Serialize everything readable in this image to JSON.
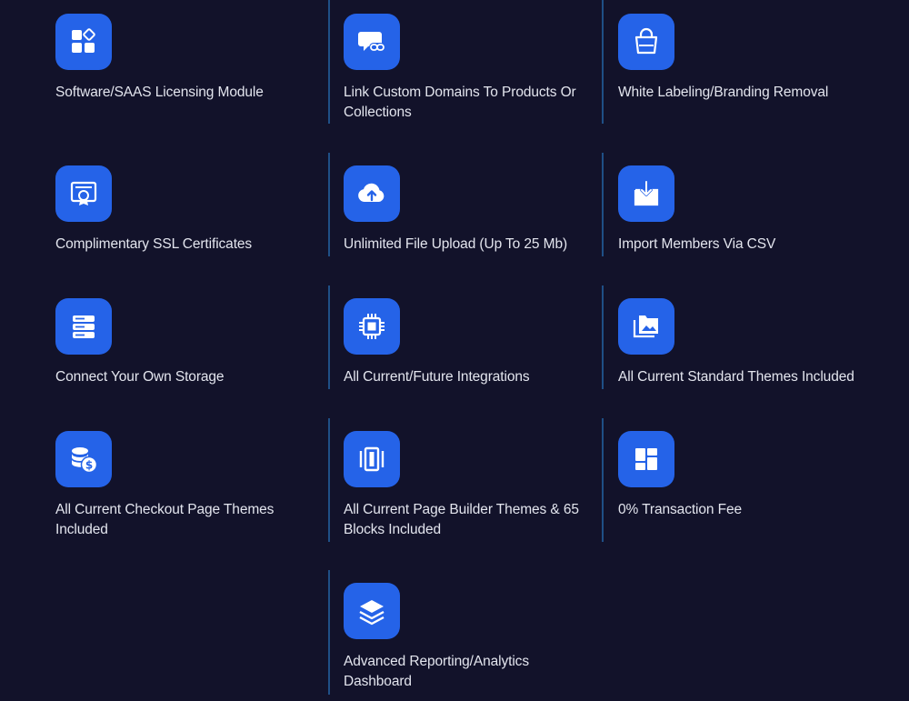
{
  "features": [
    {
      "label": "Software/SAAS Licensing Module",
      "icon": "license-blocks-icon"
    },
    {
      "label": "Link Custom Domains To Products Or Collections",
      "icon": "chat-link-icon"
    },
    {
      "label": "White Labeling/Branding Removal",
      "icon": "shopping-bag-icon"
    },
    {
      "label": "Complimentary SSL Certificates",
      "icon": "certificate-icon"
    },
    {
      "label": "Unlimited File Upload (Up To 25 Mb)",
      "icon": "cloud-upload-icon"
    },
    {
      "label": "Import Members Via CSV",
      "icon": "import-tray-icon"
    },
    {
      "label": "Connect Your Own Storage",
      "icon": "server-storage-icon"
    },
    {
      "label": "All Current/Future Integrations",
      "icon": "chip-icon"
    },
    {
      "label": "All Current Standard Themes Included",
      "icon": "image-library-icon"
    },
    {
      "label": "All Current Checkout Page Themes Included",
      "icon": "coins-dollar-icon"
    },
    {
      "label": "All Current Page Builder Themes & 65 Blocks Included",
      "icon": "carousel-blocks-icon"
    },
    {
      "label": "0% Transaction Fee",
      "icon": "dashboard-grid-icon"
    },
    {
      "label": "Advanced Reporting/Analytics Dashboard",
      "icon": "layers-icon"
    }
  ],
  "colors": {
    "background": "#12122a",
    "icon_bg": "#2563e8",
    "divider": "#1f4f86",
    "text": "#e3e5ee"
  }
}
